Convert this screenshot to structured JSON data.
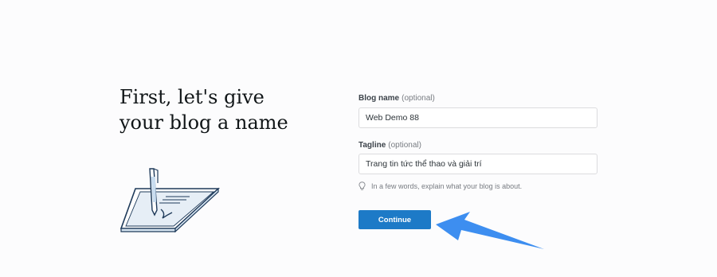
{
  "heading": {
    "line1": "First, let's give",
    "line2": "your blog a name"
  },
  "form": {
    "blog_name": {
      "label": "Blog name",
      "optional": "(optional)",
      "value": "Web Demo 88"
    },
    "tagline": {
      "label": "Tagline",
      "optional": "(optional)",
      "value": "Trang tin tức thể thao và giải trí"
    },
    "hint": {
      "icon": "lightbulb-icon",
      "text": "In a few words, explain what your blog is about."
    },
    "continue_label": "Continue"
  },
  "colors": {
    "accent": "#1d7ac7",
    "arrow": "#3d8ef0",
    "heading": "#101517"
  }
}
